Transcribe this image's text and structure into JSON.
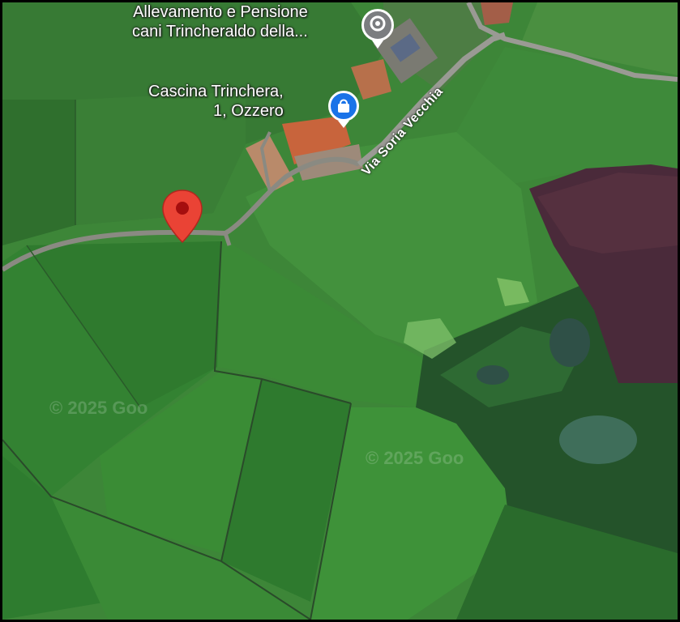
{
  "places": {
    "kennel": {
      "line1": "Allevamento e Pensione",
      "line2": "cani Trincheraldo della...",
      "icon": "place-pin-icon",
      "color": "#7b7d80"
    },
    "farmhouse": {
      "line1": "Cascina Trinchera,",
      "line2": "1, Ozzero",
      "icon": "shopping-bag-pin-icon",
      "color": "#1a73e8"
    }
  },
  "road": {
    "name": "Via Soria Vecchia"
  },
  "marker": {
    "icon": "red-location-marker-icon",
    "color": "#ea4335"
  },
  "watermarks": [
    "© 2025 Goo",
    "© 2025 Goo"
  ]
}
